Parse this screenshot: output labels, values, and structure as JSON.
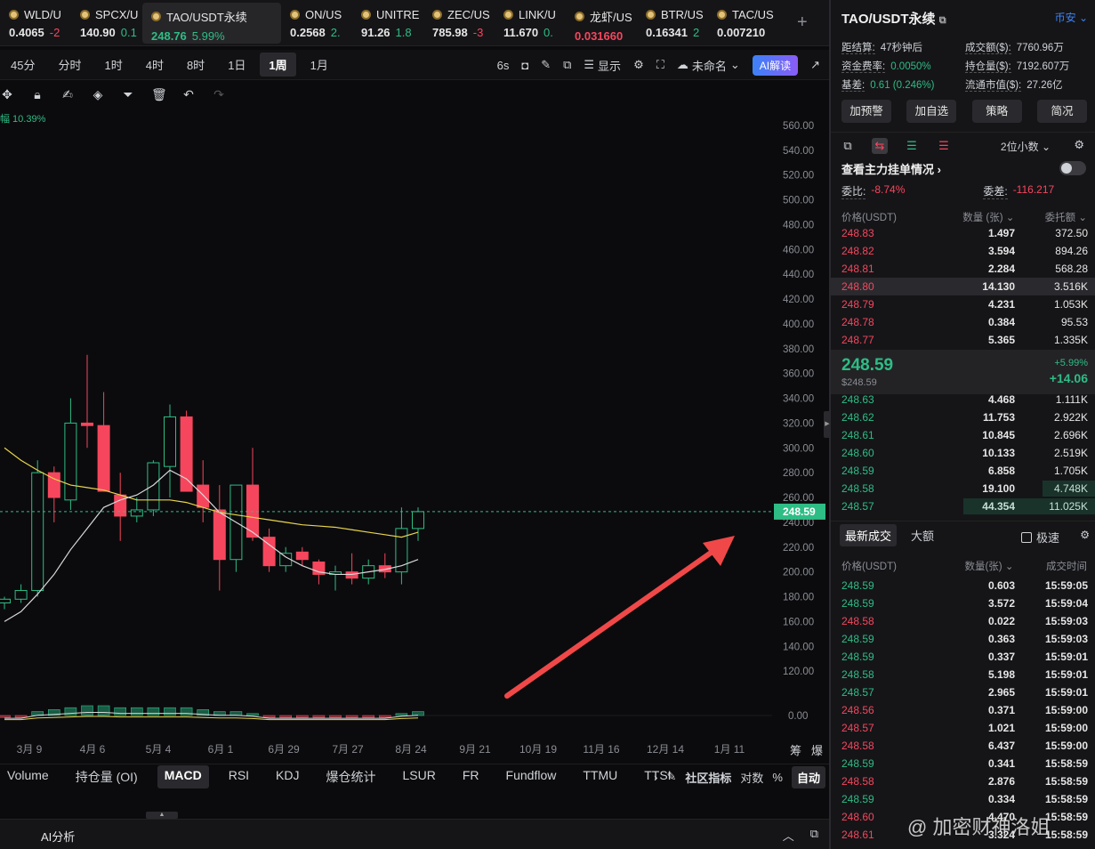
{
  "tickers": [
    {
      "symbol": "WLD/U",
      "price": "0.4065",
      "change": "-2",
      "dir": "dn"
    },
    {
      "symbol": "SPCX/U",
      "price": "140.90",
      "change": "0.1",
      "dir": "up"
    },
    {
      "symbol": "TAO/USDT永续",
      "price": "248.76",
      "change": "5.99%",
      "dir": "up",
      "active": true
    },
    {
      "symbol": "ON/US",
      "price": "0.2568",
      "change": "2.",
      "dir": "up"
    },
    {
      "symbol": "UNITRE",
      "price": "91.26",
      "change": "1.8",
      "dir": "up"
    },
    {
      "symbol": "ZEC/US",
      "price": "785.98",
      "change": "-3",
      "dir": "dn"
    },
    {
      "symbol": "LINK/U",
      "price": "11.670",
      "change": "0.",
      "dir": "up"
    },
    {
      "symbol": "龙虾/US",
      "price": "0.031660",
      "change": "",
      "dir": "dn"
    },
    {
      "symbol": "BTR/US",
      "price": "0.16341",
      "change": "2",
      "dir": "up"
    },
    {
      "symbol": "TAC/US",
      "price": "0.007210",
      "change": "",
      "dir": "up"
    }
  ],
  "timeframes": [
    "45分",
    "分时",
    "1时",
    "4时",
    "8时",
    "1日",
    "1周",
    "1月"
  ],
  "toolbar": {
    "interval": "6s",
    "display": "显示",
    "layout": "未命名",
    "ai": "AI解读"
  },
  "amplitude": "幅 10.39%",
  "chart_data": {
    "type": "candlestick",
    "x_ticks": [
      "3月 9",
      "4月 6",
      "5月 4",
      "6月 1",
      "6月 29",
      "7月 27",
      "8月 24",
      "9月 21",
      "10月 19",
      "11月 16",
      "12月 14",
      "1月 11"
    ],
    "y_ticks": [
      120,
      140,
      160,
      180,
      200,
      220,
      240,
      260,
      280,
      300,
      320,
      340,
      360,
      380,
      400,
      420,
      440,
      460,
      480,
      500,
      520,
      540,
      560
    ],
    "ylim": [
      100,
      570
    ],
    "last_price": "248.59",
    "volume_zero": "0.00",
    "candles": [
      {
        "o": 175,
        "h": 180,
        "l": 170,
        "c": 178
      },
      {
        "o": 178,
        "h": 190,
        "l": 175,
        "c": 185
      },
      {
        "o": 185,
        "h": 290,
        "l": 180,
        "c": 280
      },
      {
        "o": 280,
        "h": 285,
        "l": 240,
        "c": 260
      },
      {
        "o": 258,
        "h": 340,
        "l": 250,
        "c": 320
      },
      {
        "o": 320,
        "h": 375,
        "l": 300,
        "c": 318
      },
      {
        "o": 318,
        "h": 345,
        "l": 300,
        "c": 265
      },
      {
        "o": 262,
        "h": 280,
        "l": 225,
        "c": 245
      },
      {
        "o": 245,
        "h": 260,
        "l": 240,
        "c": 250
      },
      {
        "o": 250,
        "h": 290,
        "l": 245,
        "c": 288
      },
      {
        "o": 285,
        "h": 335,
        "l": 260,
        "c": 325
      },
      {
        "o": 325,
        "h": 330,
        "l": 265,
        "c": 265
      },
      {
        "o": 270,
        "h": 290,
        "l": 240,
        "c": 252
      },
      {
        "o": 250,
        "h": 270,
        "l": 185,
        "c": 210
      },
      {
        "o": 210,
        "h": 270,
        "l": 200,
        "c": 270
      },
      {
        "o": 270,
        "h": 300,
        "l": 225,
        "c": 228
      },
      {
        "o": 228,
        "h": 235,
        "l": 200,
        "c": 205
      },
      {
        "o": 205,
        "h": 220,
        "l": 200,
        "c": 215
      },
      {
        "o": 216,
        "h": 220,
        "l": 205,
        "c": 210
      },
      {
        "o": 208,
        "h": 210,
        "l": 190,
        "c": 198
      },
      {
        "o": 198,
        "h": 205,
        "l": 185,
        "c": 200
      },
      {
        "o": 200,
        "h": 215,
        "l": 190,
        "c": 195
      },
      {
        "o": 195,
        "h": 210,
        "l": 190,
        "c": 205
      },
      {
        "o": 205,
        "h": 215,
        "l": 195,
        "c": 200
      },
      {
        "o": 200,
        "h": 252,
        "l": 190,
        "c": 235
      },
      {
        "o": 235,
        "h": 252,
        "l": 225,
        "c": 248.59
      }
    ],
    "ma_white": [
      160,
      168,
      182,
      198,
      218,
      235,
      252,
      258,
      262,
      270,
      282,
      275,
      262,
      248,
      240,
      232,
      222,
      212,
      205,
      200,
      198,
      198,
      200,
      202,
      205,
      210
    ],
    "ma_yellow": [
      300,
      290,
      282,
      275,
      270,
      268,
      266,
      262,
      258,
      258,
      258,
      256,
      252,
      248,
      246,
      244,
      242,
      240,
      238,
      237,
      236,
      234,
      232,
      230,
      228,
      232
    ],
    "volume": [
      [
        1,
        -1
      ],
      [
        1,
        -1
      ],
      [
        1,
        2
      ],
      [
        1,
        3
      ],
      [
        1,
        4
      ],
      [
        0,
        5
      ],
      [
        1,
        5
      ],
      [
        1,
        4
      ],
      [
        1,
        4
      ],
      [
        1,
        4
      ],
      [
        1,
        4
      ],
      [
        1,
        4
      ],
      [
        1,
        3
      ],
      [
        1,
        2
      ],
      [
        1,
        2
      ],
      [
        1,
        1
      ],
      [
        1,
        -1
      ],
      [
        1,
        -1
      ],
      [
        1,
        -1
      ],
      [
        1,
        -1
      ],
      [
        1,
        -1
      ],
      [
        1,
        -1
      ],
      [
        1,
        -1
      ],
      [
        1,
        -1
      ],
      [
        1,
        1
      ],
      [
        1,
        2
      ]
    ],
    "side_labels": [
      "筹",
      "爆"
    ]
  },
  "indicators": [
    "Volume",
    "持仓量 (OI)",
    "MACD",
    "RSI",
    "KDJ",
    "爆仓统计",
    "LSUR",
    "FR",
    "Fundflow",
    "TTMU",
    "TTSI"
  ],
  "indicators_right": {
    "community": "社区指标",
    "log": "对数",
    "pct": "%",
    "auto": "自动"
  },
  "ai_bar": {
    "label": "AI分析"
  },
  "panel": {
    "title": "TAO/USDT永续",
    "exchange": "币安",
    "stats": [
      [
        {
          "k": "距结算:",
          "v": "47秒钟后",
          "dir": ""
        },
        {
          "k": "成交额($):",
          "v": "7760.96万",
          "dir": ""
        }
      ],
      [
        {
          "k": "资金费率:",
          "v": "0.0050%",
          "dir": "up"
        },
        {
          "k": "持仓量($):",
          "v": "7192.607万",
          "dir": ""
        }
      ],
      [
        {
          "k": "基差:",
          "v": "0.61 (0.246%)",
          "dir": "up"
        },
        {
          "k": "流通市值($):",
          "v": "27.26亿",
          "dir": ""
        }
      ]
    ],
    "buttons": [
      "加预警",
      "加自选",
      "策略",
      "简况"
    ],
    "decimals": "2位小数",
    "main_orders": "查看主力挂单情况",
    "ratio": {
      "k1": "委比:",
      "v1": "-8.74%",
      "k2": "委差:",
      "v2": "-116.217"
    },
    "book_header": [
      "价格(USDT)",
      "数量 (张)",
      "委托额"
    ],
    "asks": [
      {
        "p": "248.83",
        "q": "1.497",
        "t": "372.50",
        "bar": 0
      },
      {
        "p": "248.82",
        "q": "3.594",
        "t": "894.26",
        "bar": 0
      },
      {
        "p": "248.81",
        "q": "2.284",
        "t": "568.28",
        "bar": 0
      },
      {
        "p": "248.80",
        "q": "14.130",
        "t": "3.516K",
        "bar": 0,
        "hl": true
      },
      {
        "p": "248.79",
        "q": "4.231",
        "t": "1.053K",
        "bar": 0
      },
      {
        "p": "248.78",
        "q": "0.384",
        "t": "95.53",
        "bar": 0
      },
      {
        "p": "248.77",
        "q": "5.365",
        "t": "1.335K",
        "bar": 0
      }
    ],
    "mid": {
      "price": "248.59",
      "usd": "$248.59",
      "pct": "+5.99%",
      "abs": "+14.06"
    },
    "bids": [
      {
        "p": "248.63",
        "q": "4.468",
        "t": "1.111K",
        "bar": 0
      },
      {
        "p": "248.62",
        "q": "11.753",
        "t": "2.922K",
        "bar": 0
      },
      {
        "p": "248.61",
        "q": "10.845",
        "t": "2.696K",
        "bar": 0
      },
      {
        "p": "248.60",
        "q": "10.133",
        "t": "2.519K",
        "bar": 0
      },
      {
        "p": "248.59",
        "q": "6.858",
        "t": "1.705K",
        "bar": 0
      },
      {
        "p": "248.58",
        "q": "19.100",
        "t": "4.748K",
        "bar": 0.2
      },
      {
        "p": "248.57",
        "q": "44.354",
        "t": "11.025K",
        "bar": 0.5
      }
    ],
    "trades_tabs": [
      "最新成交",
      "大额"
    ],
    "fast": "极速",
    "trades_header": [
      "价格(USDT)",
      "数量(张)",
      "成交时间"
    ],
    "trades": [
      {
        "p": "248.59",
        "q": "0.603",
        "t": "15:59:05",
        "dir": "up"
      },
      {
        "p": "248.59",
        "q": "3.572",
        "t": "15:59:04",
        "dir": "up"
      },
      {
        "p": "248.58",
        "q": "0.022",
        "t": "15:59:03",
        "dir": "dn"
      },
      {
        "p": "248.59",
        "q": "0.363",
        "t": "15:59:03",
        "dir": "up"
      },
      {
        "p": "248.59",
        "q": "0.337",
        "t": "15:59:01",
        "dir": "up"
      },
      {
        "p": "248.58",
        "q": "5.198",
        "t": "15:59:01",
        "dir": "up"
      },
      {
        "p": "248.57",
        "q": "2.965",
        "t": "15:59:01",
        "dir": "up"
      },
      {
        "p": "248.56",
        "q": "0.371",
        "t": "15:59:00",
        "dir": "dn"
      },
      {
        "p": "248.57",
        "q": "1.021",
        "t": "15:59:00",
        "dir": "dn"
      },
      {
        "p": "248.58",
        "q": "6.437",
        "t": "15:59:00",
        "dir": "dn"
      },
      {
        "p": "248.59",
        "q": "0.341",
        "t": "15:58:59",
        "dir": "up"
      },
      {
        "p": "248.58",
        "q": "2.876",
        "t": "15:58:59",
        "dir": "dn"
      },
      {
        "p": "248.59",
        "q": "0.334",
        "t": "15:58:59",
        "dir": "up"
      },
      {
        "p": "248.60",
        "q": "4.470",
        "t": "15:58:59",
        "dir": "dn"
      },
      {
        "p": "248.61",
        "q": "3.324",
        "t": "15:58:59",
        "dir": "dn"
      }
    ]
  },
  "watermark": "@ 加密财神洛姐",
  "colors": {
    "up": "#2ebd85",
    "down": "#f6465d",
    "accent": "#3b82f6",
    "arrow": "#f04848"
  }
}
